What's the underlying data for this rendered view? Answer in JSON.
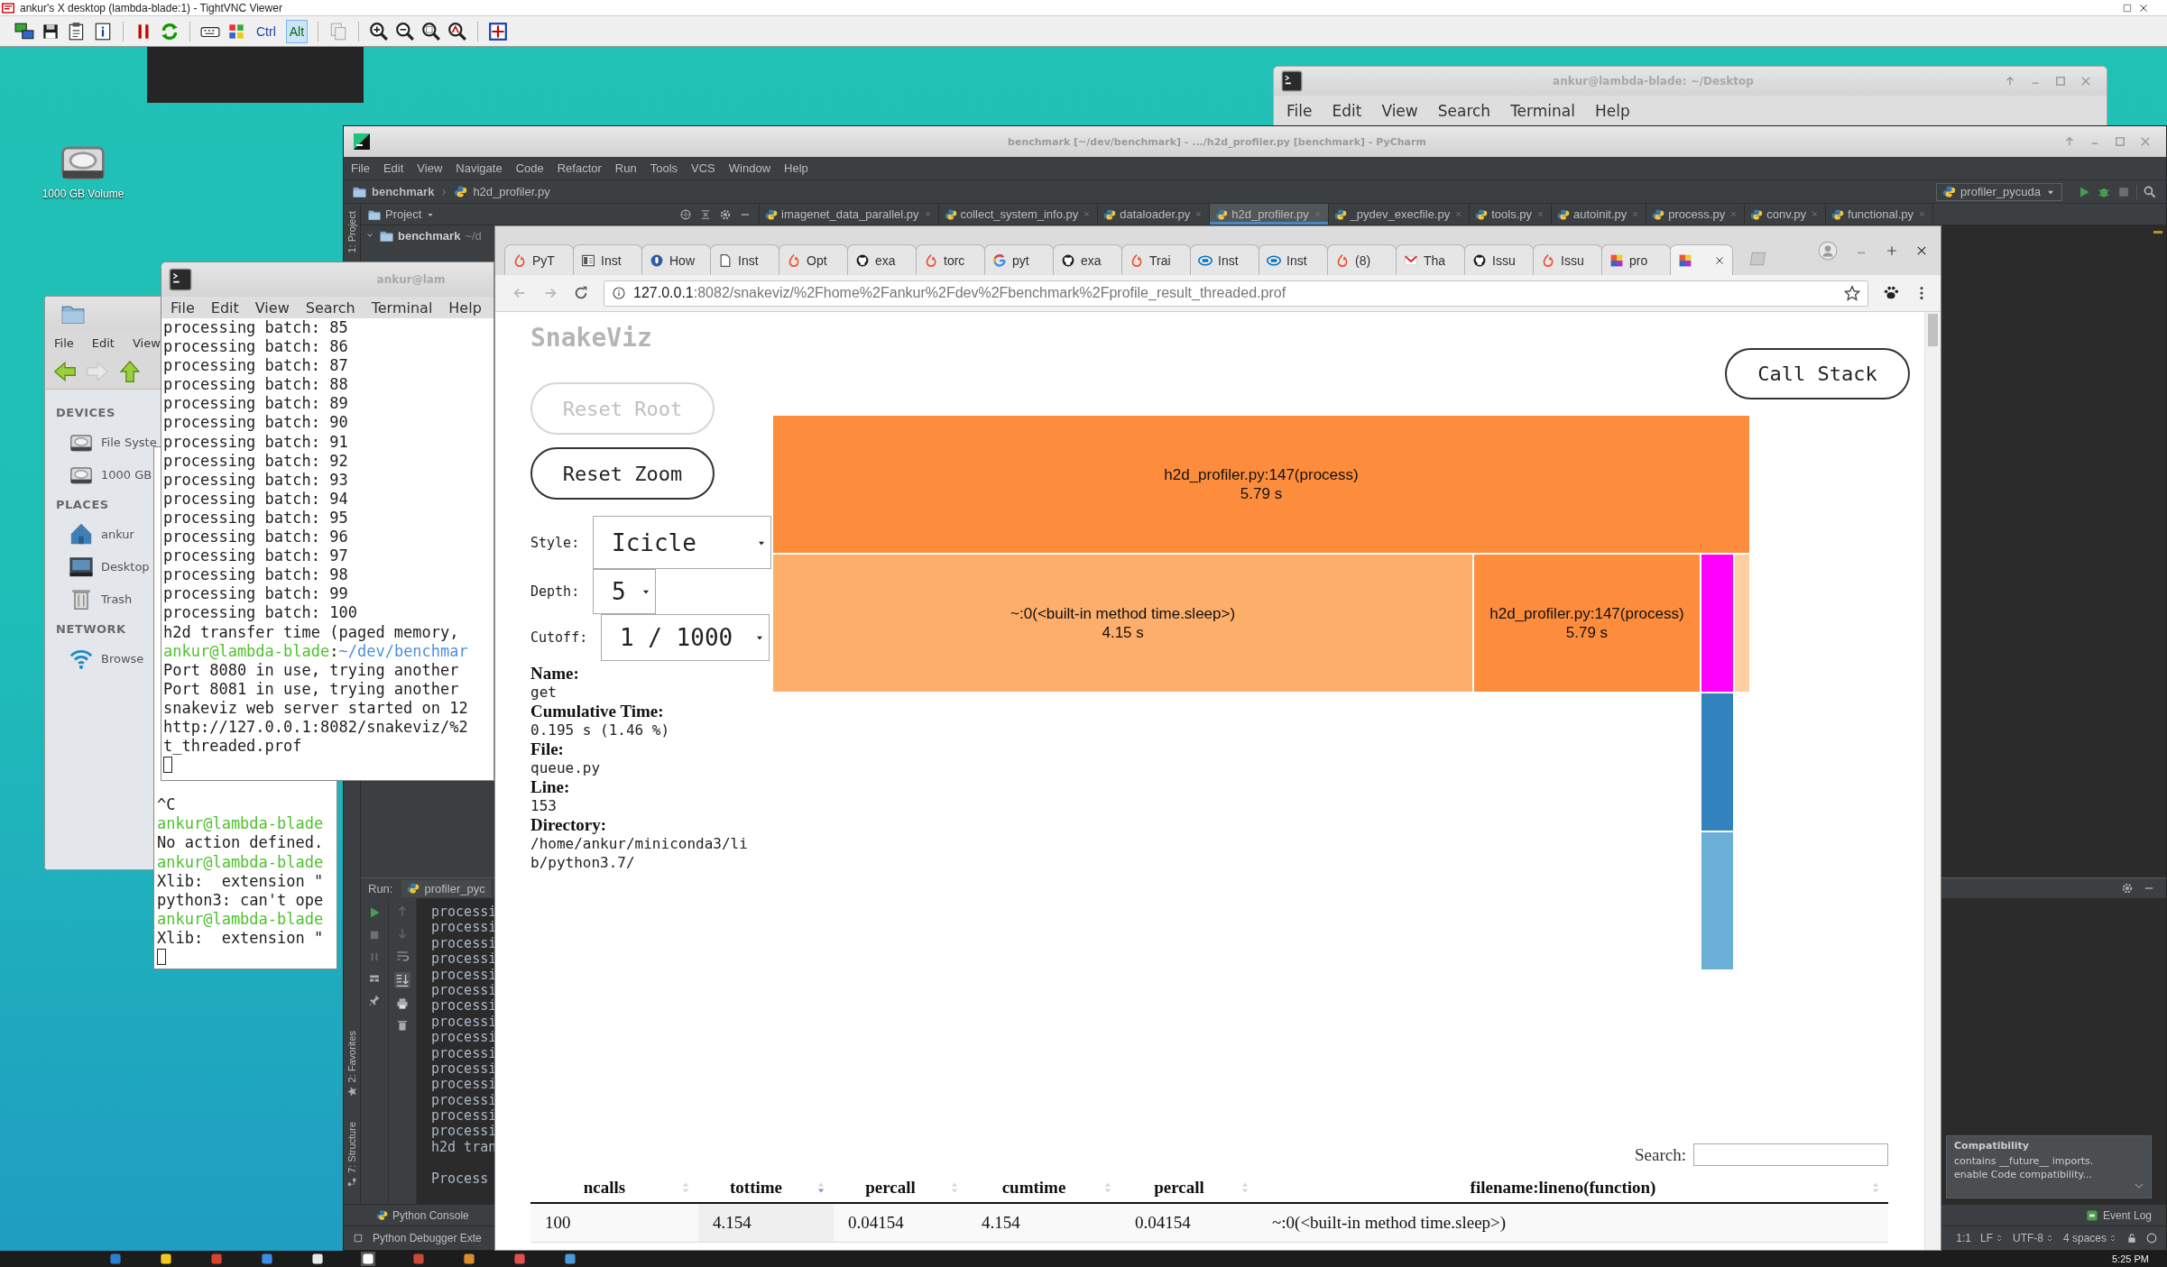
{
  "vnc": {
    "title": "ankur's X desktop (lambda-blade:1) - TightVNC Viewer",
    "keys": [
      {
        "label": "Ctrl",
        "selected": false
      },
      {
        "label": "Alt",
        "selected": true
      }
    ]
  },
  "desktop": {
    "icons": [
      {
        "label": "1000 GB Volume"
      }
    ]
  },
  "desktop_terminal": {
    "title": "ankur@lambda-blade: ~/Desktop",
    "menu": [
      "File",
      "Edit",
      "View",
      "Search",
      "Terminal",
      "Help"
    ]
  },
  "pycharm": {
    "title": "benchmark [~/dev/benchmark] - .../h2d_profiler.py [benchmark] - PyCharm",
    "menu": [
      "File",
      "Edit",
      "View",
      "Navigate",
      "Code",
      "Refactor",
      "Run",
      "Tools",
      "VCS",
      "Window",
      "Help"
    ],
    "breadcrumb": [
      "benchmark",
      "h2d_profiler.py"
    ],
    "run_config": "profiler_pycuda",
    "project_panel": {
      "title": "Project",
      "root": {
        "name": "benchmark",
        "path": "~/d"
      }
    },
    "side_tabs": [
      "1: Project",
      "2: Favorites",
      "7: Structure"
    ],
    "editor_tabs": [
      {
        "label": "imagenet_data_parallel.py",
        "selected": false
      },
      {
        "label": "collect_system_info.py",
        "selected": false
      },
      {
        "label": "dataloader.py",
        "selected": false
      },
      {
        "label": "h2d_profiler.py",
        "selected": true
      },
      {
        "label": "_pydev_execfile.py",
        "selected": false
      },
      {
        "label": "tools.py",
        "selected": false
      },
      {
        "label": "autoinit.py",
        "selected": false
      },
      {
        "label": "process.py",
        "selected": false
      },
      {
        "label": "conv.py",
        "selected": false
      },
      {
        "label": "functional.py",
        "selected": false
      }
    ],
    "run_panel": {
      "title": "Run:",
      "tab": "profiler_pyc",
      "lines": [
        {
          "text": "processi",
          "kind": "output"
        },
        {
          "text": "processi",
          "kind": "output"
        },
        {
          "text": "processi",
          "kind": "output"
        },
        {
          "text": "processi",
          "kind": "output"
        },
        {
          "text": "processi",
          "kind": "output"
        },
        {
          "text": "processi",
          "kind": "output"
        },
        {
          "text": "processi",
          "kind": "output"
        },
        {
          "text": "processi",
          "kind": "output"
        },
        {
          "text": "processi",
          "kind": "output"
        },
        {
          "text": "processi",
          "kind": "output"
        },
        {
          "text": "processi",
          "kind": "output"
        },
        {
          "text": "processi",
          "kind": "output"
        },
        {
          "text": "processi",
          "kind": "output"
        },
        {
          "text": "processi",
          "kind": "output"
        },
        {
          "text": "processi",
          "kind": "output"
        },
        {
          "text": "h2d tran",
          "kind": "output"
        },
        {
          "text": "Process",
          "kind": "exit"
        }
      ]
    },
    "tool_tabs": {
      "console": "Python Console",
      "event_log": "Event Log"
    },
    "notification": {
      "title": "Compatibility",
      "lines": [
        "contains __future__ imports.",
        "enable Code compatibility..."
      ]
    },
    "status": {
      "message": "Python Debugger Exte",
      "items": [
        {
          "label": "1:1",
          "dropdown": false
        },
        {
          "label": "LF",
          "dropdown": true
        },
        {
          "label": "UTF-8",
          "dropdown": true
        },
        {
          "label": "4 spaces",
          "dropdown": true
        }
      ]
    }
  },
  "file_manager": {
    "menu": [
      "File",
      "Edit",
      "View"
    ],
    "sections": [
      {
        "title": "DEVICES",
        "items": [
          "File Syste",
          "1000 GB"
        ]
      },
      {
        "title": "PLACES",
        "items": [
          "ankur",
          "Desktop",
          "Trash"
        ]
      },
      {
        "title": "NETWORK",
        "items": [
          "Browse"
        ]
      }
    ]
  },
  "back_terminal": {
    "lines": [
      {
        "text": "^C"
      },
      {
        "parts": [
          {
            "text": "ankur@lambda-blade",
            "kind": "user"
          }
        ]
      },
      {
        "text": "No action defined."
      },
      {
        "parts": [
          {
            "text": "ankur@lambda-blade",
            "kind": "user"
          }
        ]
      },
      {
        "text": "Xlib:  extension \""
      },
      {
        "text": "python3: can't ope"
      },
      {
        "parts": [
          {
            "text": "ankur@lambda-blade",
            "kind": "user"
          }
        ]
      },
      {
        "text": "Xlib:  extension \""
      }
    ]
  },
  "terminal": {
    "title": "ankur@lam",
    "menu": [
      "File",
      "Edit",
      "View",
      "Search",
      "Terminal",
      "Help"
    ],
    "lines": [
      {
        "text": "processing batch: 85"
      },
      {
        "text": "processing batch: 86"
      },
      {
        "text": "processing batch: 87"
      },
      {
        "text": "processing batch: 88"
      },
      {
        "text": "processing batch: 89"
      },
      {
        "text": "processing batch: 90"
      },
      {
        "text": "processing batch: 91"
      },
      {
        "text": "processing batch: 92"
      },
      {
        "text": "processing batch: 93"
      },
      {
        "text": "processing batch: 94"
      },
      {
        "text": "processing batch: 95"
      },
      {
        "text": "processing batch: 96"
      },
      {
        "text": "processing batch: 97"
      },
      {
        "text": "processing batch: 98"
      },
      {
        "text": "processing batch: 99"
      },
      {
        "text": "processing batch: 100"
      },
      {
        "text": "h2d transfer time (paged memory,"
      },
      {
        "parts": [
          {
            "text": "ankur@lambda-blade",
            "kind": "user"
          },
          {
            "text": ":",
            "kind": "plain"
          },
          {
            "text": "~/dev/benchmar",
            "kind": "path"
          }
        ]
      },
      {
        "text": "Port 8080 in use, trying another"
      },
      {
        "text": "Port 8081 in use, trying another"
      },
      {
        "text": "snakeviz web server started on 12"
      },
      {
        "text": "http://127.0.0.1:8082/snakeviz/%2"
      },
      {
        "text": "t_threaded.prof"
      }
    ]
  },
  "browser": {
    "tabs": [
      {
        "label": "PyT",
        "selected": false
      },
      {
        "label": "Inst",
        "selected": false
      },
      {
        "label": "How",
        "selected": false
      },
      {
        "label": "Inst",
        "selected": false
      },
      {
        "label": "Opt",
        "selected": false
      },
      {
        "label": "exa",
        "selected": false
      },
      {
        "label": "torc",
        "selected": false
      },
      {
        "label": "pyt",
        "selected": false
      },
      {
        "label": "exa",
        "selected": false
      },
      {
        "label": "Trai",
        "selected": false
      },
      {
        "label": "Inst",
        "selected": false
      },
      {
        "label": "Inst",
        "selected": false
      },
      {
        "label": "(8)",
        "selected": false
      },
      {
        "label": "Tha",
        "selected": false
      },
      {
        "label": "Issu",
        "selected": false
      },
      {
        "label": "Issu",
        "selected": false
      },
      {
        "label": "pro",
        "selected": false
      },
      {
        "selected": true
      }
    ],
    "url": {
      "host": "127.0.0.1",
      "path": ":8082/snakeviz/%2Fhome%2Fankur%2Fdev%2Fbenchmark%2Fprofile_result_threaded.prof"
    },
    "snakeviz": {
      "title": "SnakeViz",
      "buttons": [
        {
          "label": "Reset Root",
          "disabled": true
        },
        {
          "label": "Reset Zoom",
          "disabled": false
        }
      ],
      "call_stack": "Call Stack",
      "controls": [
        {
          "label": "Style:",
          "value": "Icicle"
        },
        {
          "label": "Depth:",
          "value": "5"
        },
        {
          "label": "Cutoff:",
          "value": "1 / 1000"
        }
      ],
      "info": [
        {
          "label": "Name:",
          "value": "get"
        },
        {
          "label": "Cumulative Time:",
          "value": "0.195 s (1.46 %)"
        },
        {
          "label": "File:",
          "value": "queue.py"
        },
        {
          "label": "Line:",
          "value": "153"
        },
        {
          "label": "Directory:",
          "value": "/home/ankur/miniconda3/lib/python3.7/"
        }
      ],
      "icicle": {
        "rows": [
          {
            "segments": [
              {
                "label": "h2d_profiler.py:147(process)",
                "time": "5.79 s",
                "color": "#fd8d3c"
              }
            ]
          },
          {
            "segments": [
              {
                "label": "~:0(<built-in method time.sleep>)",
                "time": "4.15 s",
                "color": "#fdae6b"
              },
              {
                "label": "h2d_profiler.py:147(process)",
                "time": "5.79 s",
                "color": "#fd8d3c"
              },
              {
                "color": "#ff00ff"
              },
              {
                "color": "#fdd0a2"
              }
            ]
          },
          {
            "segments": [
              {
                "color": "#3182bd"
              }
            ]
          },
          {
            "segments": [
              {
                "color": "#6baed6"
              }
            ]
          }
        ]
      },
      "search": {
        "label": "Search:"
      },
      "table": {
        "columns": [
          {
            "label": "ncalls",
            "sorted": false
          },
          {
            "label": "tottime",
            "sorted": true
          },
          {
            "label": "percall",
            "sorted": false
          },
          {
            "label": "cumtime",
            "sorted": false
          },
          {
            "label": "percall",
            "sorted": false
          },
          {
            "label": "filename:lineno(function)",
            "sorted": false
          }
        ],
        "rows": [
          {
            "cells": [
              "100",
              "4.154",
              "0.04154",
              "4.154",
              "0.04154",
              "~:0(<built-in method time.sleep>)"
            ]
          }
        ]
      }
    }
  },
  "taskbar": {
    "clock": "5:25 PM"
  }
}
